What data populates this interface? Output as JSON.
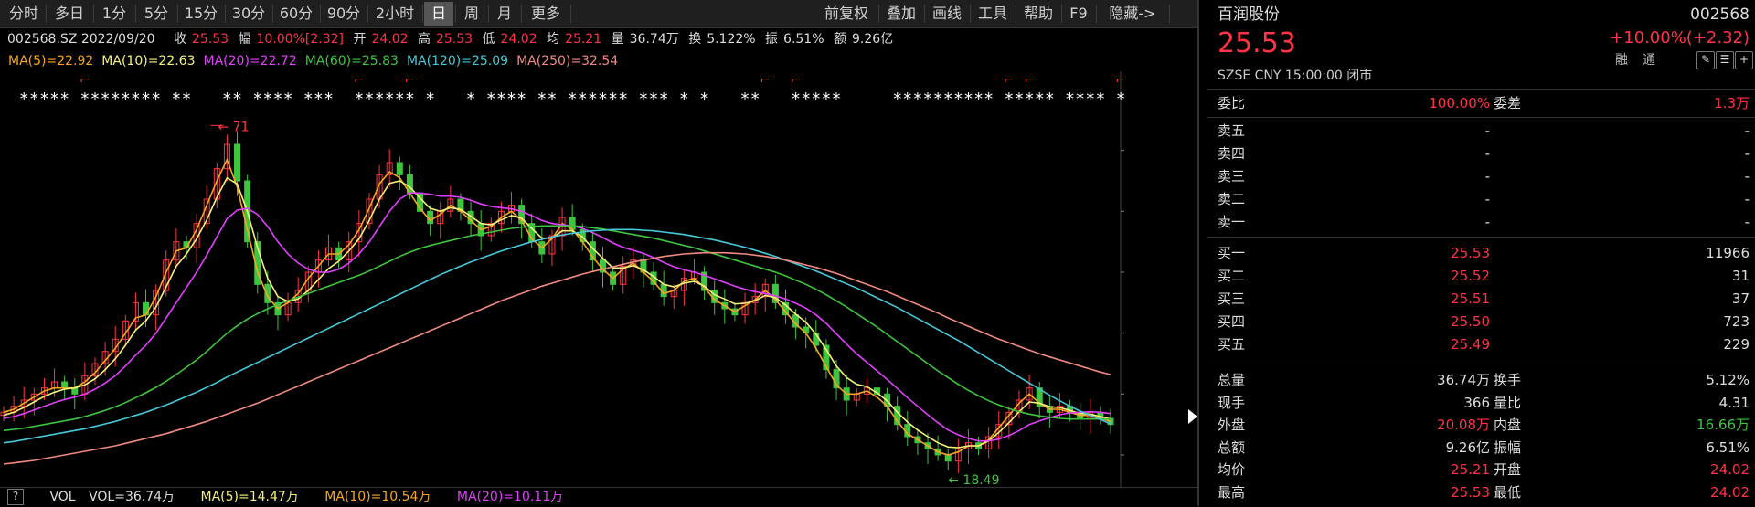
{
  "toolbar": {
    "left_tabs": [
      "分时",
      "多日",
      "1分",
      "5分",
      "15分",
      "30分",
      "60分",
      "90分",
      "2小时",
      "日",
      "周",
      "月",
      "更多"
    ],
    "active_tab": "日",
    "right_buttons": [
      "前复权",
      "叠加",
      "画线",
      "工具",
      "帮助",
      "F9",
      "隐藏->"
    ]
  },
  "info": {
    "code_date": "002568.SZ 2022/09/20",
    "close_label": "收",
    "close": "25.53",
    "range_label": "幅",
    "range": "10.00%[2.32]",
    "open_label": "开",
    "open": "24.02",
    "high_label": "高",
    "high": "25.53",
    "low_label": "低",
    "low": "24.02",
    "avg_label": "均",
    "avg": "25.21",
    "vol_label": "量",
    "vol": "36.74万",
    "turnover_label": "换",
    "turnover": "5.122%",
    "amp_label": "振",
    "amp": "6.51%",
    "amount_label": "额",
    "amount": "9.26亿"
  },
  "ma": [
    {
      "text": "MA(5)=22.92",
      "color": "#f5a623"
    },
    {
      "text": "MA(10)=22.63",
      "color": "#f5f07a"
    },
    {
      "text": "MA(20)=22.72",
      "color": "#e040fb"
    },
    {
      "text": "MA(60)=25.83",
      "color": "#3fc43f"
    },
    {
      "text": "MA(120)=25.09",
      "color": "#46c8d8"
    },
    {
      "text": "MA(250)=32.54",
      "color": "#f08a80"
    }
  ],
  "chart_data": {
    "type": "line",
    "title": "",
    "y_ticks": [
      70,
      60,
      50,
      40,
      30,
      20
    ],
    "ylim": [
      17,
      74
    ],
    "annotations": {
      "high_label": "71",
      "low_label": "18.49"
    },
    "close_series": [
      27,
      28,
      29,
      30,
      31,
      32,
      31,
      30,
      33,
      35,
      37,
      39,
      42,
      45,
      43,
      47,
      52,
      55,
      54,
      58,
      62,
      67,
      71,
      65,
      55,
      48,
      45,
      43,
      45,
      47,
      50,
      52,
      54,
      52,
      55,
      58,
      62,
      66,
      68,
      66,
      63,
      60,
      58,
      60,
      62,
      60,
      58,
      56,
      58,
      60,
      61,
      58,
      55,
      53,
      56,
      59,
      57,
      55,
      52,
      50,
      48,
      51,
      52,
      50,
      48,
      46,
      47,
      49,
      50,
      47,
      45,
      44,
      43,
      45,
      46,
      48,
      45,
      43,
      41,
      40,
      38,
      34,
      31,
      29,
      30,
      31,
      30,
      28,
      25,
      23,
      22,
      21,
      20,
      19,
      21,
      22,
      21,
      23,
      25,
      27,
      29,
      31,
      28,
      27,
      28,
      27,
      26,
      27,
      26,
      25
    ],
    "series": [
      {
        "name": "MA(5)",
        "color": "#f5a623",
        "values": [
          27,
          27.5,
          28.5,
          29.5,
          30.5,
          31,
          31,
          31,
          32,
          33.5,
          35.5,
          37.5,
          40,
          42.5,
          43,
          46,
          50,
          53.5,
          54,
          57,
          61,
          65,
          68.5,
          64,
          57,
          50,
          46,
          44,
          45,
          46.5,
          49,
          51,
          53,
          53,
          54.5,
          57,
          60.5,
          64.5,
          66.5,
          65.5,
          63,
          60.5,
          58.5,
          59.5,
          61,
          60,
          58.5,
          57,
          57.5,
          59,
          60,
          58.5,
          55.5,
          54,
          55.5,
          58,
          57,
          55,
          52.5,
          50.5,
          49,
          50.5,
          51.5,
          50,
          48.5,
          46.5,
          47,
          48.5,
          49,
          47.5,
          45.5,
          44.5,
          43.5,
          44.5,
          45.5,
          47,
          45.5,
          43.5,
          41.5,
          40,
          37.5,
          34.5,
          31.5,
          30,
          30,
          30.5,
          29.5,
          28,
          25.5,
          23.5,
          22.5,
          21.5,
          20.5,
          20,
          20.5,
          21.5,
          21.5,
          22.5,
          24.5,
          26.5,
          28.5,
          30,
          28.5,
          27.5,
          27.5,
          27,
          26.5,
          26.5,
          26,
          25.5
        ]
      },
      {
        "name": "MA(10)",
        "color": "#f5f07a",
        "values": [
          26.5,
          27,
          27.8,
          28.7,
          29.6,
          30.3,
          30.8,
          31,
          31.5,
          32.5,
          34,
          35.8,
          38,
          40.5,
          42,
          44.3,
          47.6,
          51,
          53,
          55.5,
          58.6,
          62.3,
          65.5,
          64.5,
          60,
          54,
          49,
          46,
          45.2,
          45.6,
          47,
          48.8,
          50.6,
          51.8,
          53.5,
          55.5,
          58.5,
          62,
          64.6,
          65,
          64,
          62.2,
          60.5,
          60,
          60.6,
          60.3,
          59.2,
          58,
          57.8,
          58.6,
          59.3,
          58.9,
          57.2,
          55.6,
          55.6,
          56.8,
          56.8,
          55.8,
          53.9,
          52.3,
          50.7,
          50.7,
          51.1,
          50.4,
          49.3,
          48,
          47.6,
          48.2,
          48.5,
          47.7,
          46.3,
          45.6,
          44.8,
          44.9,
          45.3,
          46.2,
          45.8,
          44.6,
          43.1,
          41.8,
          39.8,
          37.3,
          34.6,
          32.7,
          31.6,
          31.2,
          30.2,
          28.9,
          27,
          25.4,
          24.1,
          23,
          22,
          21.3,
          21.2,
          21.5,
          21.5,
          22.3,
          23.7,
          25.3,
          27.1,
          28.7,
          28.5,
          27.9,
          27.8,
          27.3,
          26.8,
          26.7,
          26.3,
          25.9
        ]
      },
      {
        "name": "MA(20)",
        "color": "#e040fb",
        "values": [
          26,
          26.3,
          26.8,
          27.4,
          28,
          28.6,
          29.1,
          29.5,
          30,
          30.8,
          31.8,
          33,
          34.6,
          36.4,
          38,
          40,
          42.5,
          45,
          47.5,
          50,
          52.8,
          55.8,
          58.8,
          60.2,
          60.5,
          59.5,
          57.5,
          55,
          53,
          51.5,
          50.5,
          50,
          50,
          50.5,
          51.5,
          53,
          55,
          57.5,
          60,
          62,
          63,
          63,
          62.8,
          62.5,
          62.5,
          62.3,
          61.8,
          61.2,
          60.8,
          60.6,
          60.4,
          60,
          59.3,
          58.5,
          58,
          57.8,
          57.6,
          57.2,
          56.5,
          55.7,
          54.8,
          54.1,
          53.6,
          53.1,
          52.4,
          51.6,
          50.9,
          50.4,
          50,
          49.5,
          48.9,
          48.3,
          47.7,
          47.2,
          46.8,
          46.5,
          46.1,
          45.6,
          44.9,
          44.1,
          43,
          41.6,
          39.9,
          38.2,
          36.6,
          35.2,
          33.8,
          32.4,
          30.9,
          29.4,
          28,
          26.6,
          25.3,
          24.1,
          23.3,
          22.7,
          22.3,
          22.3,
          22.6,
          23.2,
          24,
          25,
          25.6,
          26.1,
          26.6,
          26.9,
          27,
          27.1,
          27,
          26.8
        ]
      },
      {
        "name": "MA(60)",
        "color": "#3fc43f",
        "values": [
          24,
          24.2,
          24.4,
          24.7,
          25,
          25.3,
          25.6,
          25.9,
          26.3,
          26.8,
          27.3,
          27.9,
          28.6,
          29.4,
          30.2,
          31.1,
          32.1,
          33.2,
          34.4,
          35.6,
          37,
          38.5,
          40,
          41.2,
          42.3,
          43.2,
          44,
          44.7,
          45.3,
          45.9,
          46.5,
          47.1,
          47.7,
          48.3,
          48.9,
          49.5,
          50.2,
          51,
          51.8,
          52.6,
          53.3,
          53.9,
          54.4,
          54.8,
          55.2,
          55.6,
          56,
          56.3,
          56.6,
          56.9,
          57.2,
          57.4,
          57.5,
          57.6,
          57.6,
          57.6,
          57.6,
          57.5,
          57.3,
          57.1,
          56.8,
          56.5,
          56.2,
          55.9,
          55.6,
          55.2,
          54.8,
          54.4,
          54,
          53.5,
          53,
          52.5,
          52,
          51.5,
          51,
          50.5,
          50,
          49.4,
          48.7,
          48,
          47.2,
          46.3,
          45.3,
          44.3,
          43.2,
          42.1,
          41,
          39.8,
          38.6,
          37.4,
          36.2,
          35,
          33.8,
          32.7,
          31.6,
          30.6,
          29.7,
          28.9,
          28.2,
          27.6,
          27.1,
          26.7,
          26.4,
          26.2,
          26,
          25.9,
          25.9,
          25.9,
          25.9,
          25.9
        ]
      },
      {
        "name": "MA(120)",
        "color": "#46c8d8",
        "values": [
          22,
          22.2,
          22.5,
          22.8,
          23.1,
          23.4,
          23.7,
          24,
          24.3,
          24.7,
          25.1,
          25.5,
          26,
          26.5,
          27,
          27.6,
          28.2,
          28.9,
          29.6,
          30.3,
          31.1,
          31.9,
          32.8,
          33.6,
          34.4,
          35.2,
          36,
          36.8,
          37.6,
          38.4,
          39.2,
          40,
          40.8,
          41.6,
          42.4,
          43.2,
          44,
          44.8,
          45.6,
          46.4,
          47.2,
          48,
          48.8,
          49.6,
          50.3,
          51,
          51.7,
          52.3,
          52.9,
          53.5,
          54,
          54.5,
          55,
          55.4,
          55.8,
          56.1,
          56.4,
          56.6,
          56.8,
          56.9,
          57,
          57,
          57,
          56.9,
          56.8,
          56.6,
          56.4,
          56.2,
          55.9,
          55.6,
          55.3,
          54.9,
          54.5,
          54.1,
          53.6,
          53.1,
          52.6,
          52,
          51.4,
          50.8,
          50.2,
          49.5,
          48.8,
          48.1,
          47.4,
          46.6,
          45.8,
          45,
          44.2,
          43.3,
          42.4,
          41.5,
          40.6,
          39.7,
          38.8,
          37.8,
          36.8,
          35.8,
          34.8,
          33.8,
          32.8,
          31.8,
          30.8,
          29.8,
          28.9,
          28,
          27.2,
          26.5,
          25.8,
          25.1
        ]
      },
      {
        "name": "MA(250)",
        "color": "#f08a80",
        "values": [
          18.5,
          18.7,
          18.9,
          19.1,
          19.4,
          19.7,
          20,
          20.3,
          20.6,
          20.9,
          21.2,
          21.5,
          21.9,
          22.3,
          22.7,
          23.1,
          23.5,
          24,
          24.5,
          25,
          25.5,
          26.1,
          26.7,
          27.3,
          27.9,
          28.5,
          29.2,
          29.9,
          30.6,
          31.3,
          32,
          32.7,
          33.4,
          34.1,
          34.8,
          35.5,
          36.2,
          36.9,
          37.6,
          38.3,
          39,
          39.7,
          40.4,
          41.1,
          41.8,
          42.5,
          43.2,
          43.9,
          44.6,
          45.3,
          45.9,
          46.5,
          47.1,
          47.7,
          48.2,
          48.7,
          49.2,
          49.7,
          50.1,
          50.5,
          50.9,
          51.3,
          51.7,
          52,
          52.3,
          52.6,
          52.8,
          53,
          53.1,
          53.2,
          53.2,
          53.2,
          53.1,
          53,
          52.8,
          52.6,
          52.3,
          52,
          51.6,
          51.2,
          50.8,
          50.3,
          49.8,
          49.2,
          48.6,
          48,
          47.4,
          46.8,
          46.1,
          45.4,
          44.7,
          44,
          43.3,
          42.5,
          41.8,
          41.1,
          40.4,
          39.7,
          39,
          38.4,
          37.8,
          37.2,
          36.6,
          36.1,
          35.6,
          35.1,
          34.6,
          34.1,
          33.6,
          33.2
        ]
      }
    ],
    "marker_glyph": "*",
    "flag_glyph": "⌐"
  },
  "vol": {
    "help": "?",
    "label": "VOL",
    "vol": "VOL=36.74万",
    "ma5": "MA(5)=14.47万",
    "ma10": "MA(10)=10.54万",
    "ma20": "MA(20)=10.11万",
    "ma5_color": "#f5f07a",
    "ma10_color": "#f5a623",
    "ma20_color": "#e040fb"
  },
  "panel": {
    "name": "百润股份",
    "code": "002568",
    "price": "25.53",
    "change": "+10.00%(+2.32)",
    "tags": [
      "融",
      "通"
    ],
    "meta": "SZSE  CNY  15:00:00  闭市",
    "wb_label": "委比",
    "wb_value": "100.00%",
    "wc_label": "委差",
    "wc_value": "1.3万",
    "asks": [
      {
        "label": "卖五",
        "price": "-",
        "vol": "-"
      },
      {
        "label": "卖四",
        "price": "-",
        "vol": "-"
      },
      {
        "label": "卖三",
        "price": "-",
        "vol": "-"
      },
      {
        "label": "卖二",
        "price": "-",
        "vol": "-"
      },
      {
        "label": "卖一",
        "price": "-",
        "vol": "-"
      }
    ],
    "bids": [
      {
        "label": "买一",
        "price": "25.53",
        "vol": "11966"
      },
      {
        "label": "买二",
        "price": "25.52",
        "vol": "31"
      },
      {
        "label": "买三",
        "price": "25.51",
        "vol": "37"
      },
      {
        "label": "买四",
        "price": "25.50",
        "vol": "723"
      },
      {
        "label": "买五",
        "price": "25.49",
        "vol": "229"
      }
    ],
    "stats": [
      {
        "l1": "总量",
        "v1": "36.74万",
        "l2": "换手",
        "v2": "5.12%",
        "c1": "#ddd",
        "c2": "#ddd"
      },
      {
        "l1": "现手",
        "v1": "366",
        "l2": "量比",
        "v2": "4.31",
        "c1": "#ddd",
        "c2": "#ddd"
      },
      {
        "l1": "外盘",
        "v1": "20.08万",
        "l2": "内盘",
        "v2": "16.66万",
        "c1": "#ff3344",
        "c2": "#3fc43f"
      },
      {
        "l1": "总额",
        "v1": "9.26亿",
        "l2": "振幅",
        "v2": "6.51%",
        "c1": "#ddd",
        "c2": "#ddd"
      },
      {
        "l1": "均价",
        "v1": "25.21",
        "l2": "开盘",
        "v2": "24.02",
        "c1": "#ff3344",
        "c2": "#ff3344"
      },
      {
        "l1": "最高",
        "v1": "25.53",
        "l2": "最低",
        "v2": "24.02",
        "c1": "#ff3344",
        "c2": "#ff3344"
      }
    ]
  },
  "colors": {
    "up": "#ff3344",
    "down": "#3fc43f",
    "accent": "#ff3344"
  }
}
